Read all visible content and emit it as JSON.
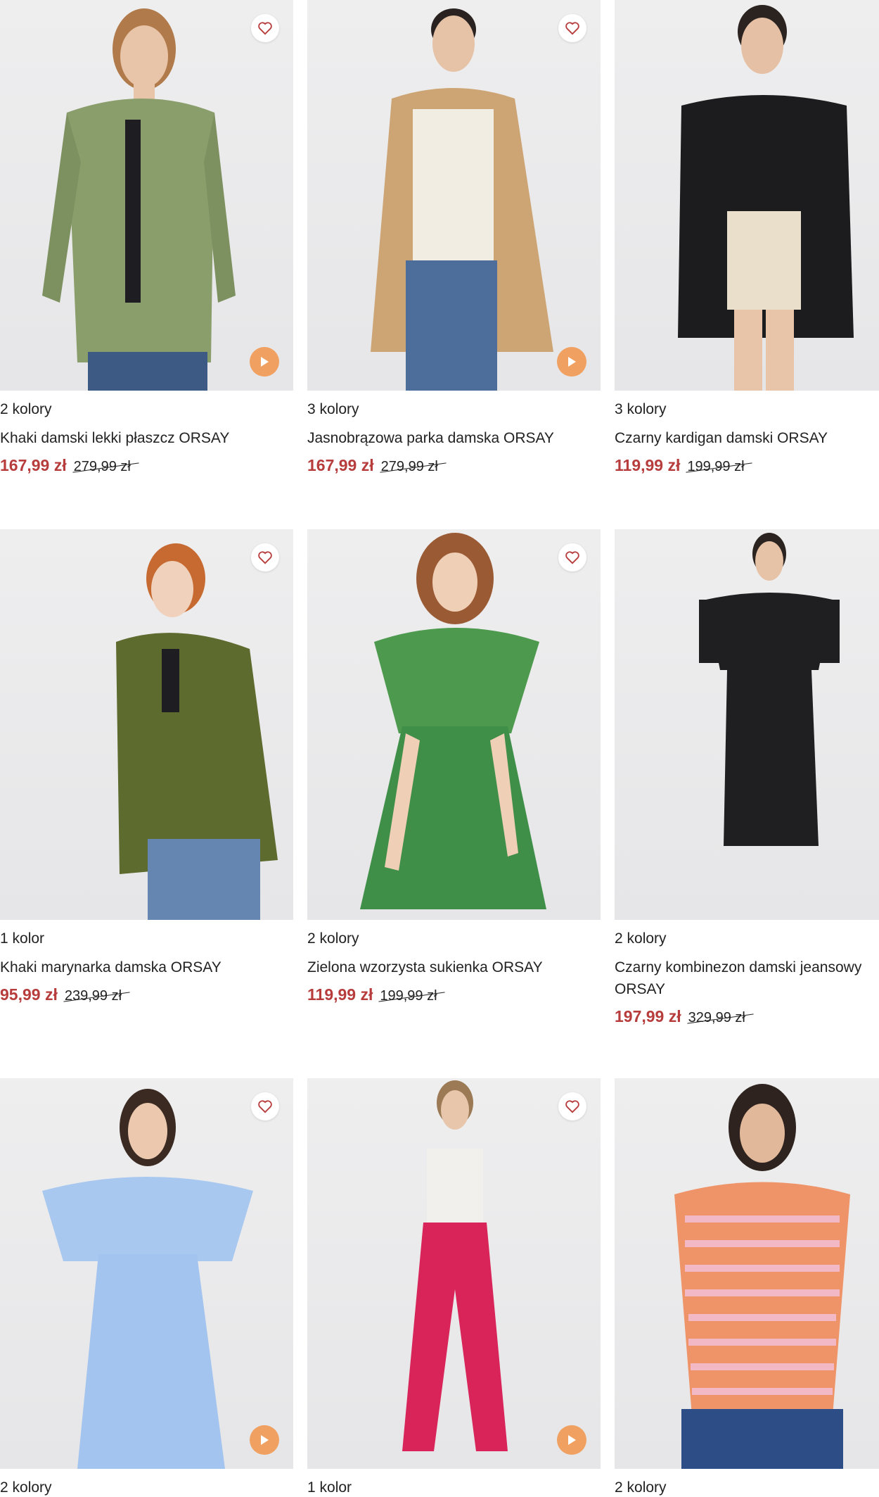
{
  "colors": {
    "price_sale": "#b73c3c",
    "play_button": "#f0a060",
    "text": "#222222"
  },
  "products": [
    {
      "colors_label": "2 kolory",
      "name": "Khaki damski lekki płaszcz ORSAY",
      "price": "167,99 zł",
      "old_price": "279,99 zł"
    },
    {
      "colors_label": "3 kolory",
      "name": "Jasnobrązowa parka damska ORSAY",
      "price": "167,99 zł",
      "old_price": "279,99 zł"
    },
    {
      "colors_label": "3 kolory",
      "name": "Czarny kardigan damski ORSAY",
      "price": "119,99 zł",
      "old_price": "199,99 zł"
    },
    {
      "colors_label": "1 kolor",
      "name": "Khaki marynarka damska ORSAY",
      "price": "95,99 zł",
      "old_price": "239,99 zł"
    },
    {
      "colors_label": "2 kolory",
      "name": "Zielona wzorzysta sukienka ORSAY",
      "price": "119,99 zł",
      "old_price": "199,99 zł"
    },
    {
      "colors_label": "2 kolory",
      "name": "Czarny kombinezon damski jeansowy ORSAY",
      "price": "197,99 zł",
      "old_price": "329,99 zł"
    },
    {
      "colors_label": "2 kolory"
    },
    {
      "colors_label": "1 kolor"
    },
    {
      "colors_label": "2 kolory"
    }
  ],
  "icons": {
    "favorite": "heart-icon",
    "video": "play-icon"
  }
}
